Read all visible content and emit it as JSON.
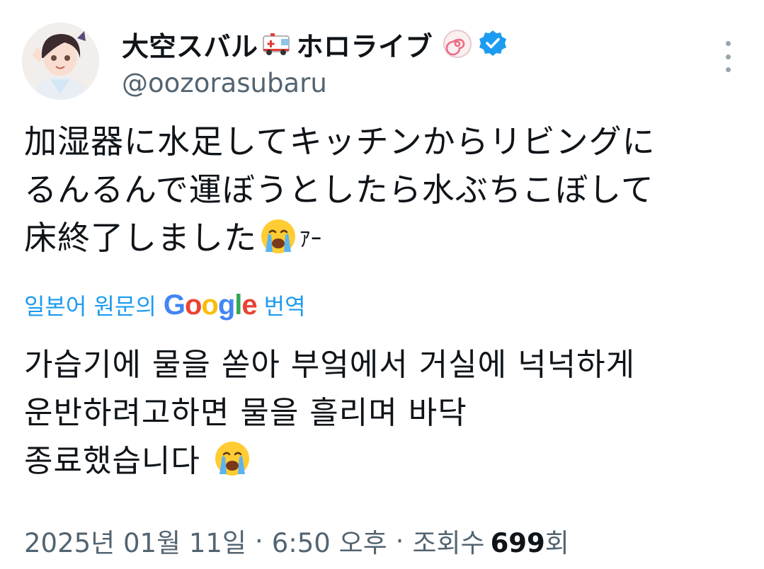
{
  "author": {
    "display_name": "大空スバル",
    "display_name_suffix": "ホロライブ",
    "handle": "@oozorasubaru",
    "verified_color": "#1d9bf0",
    "icons": [
      "ambulance-icon",
      "naruto-badge-icon",
      "verified-badge-icon"
    ]
  },
  "original_text": {
    "line1": "加湿器に水足してキッチンからリビングに",
    "line2": "るんるんで運ぼうとしたら水ぶちこぼして",
    "line3_before": "床終了しました",
    "line3_after": "ｱｰ"
  },
  "translate": {
    "prefix": "일본어 원문의",
    "google": [
      "G",
      "o",
      "o",
      "g",
      "l",
      "e"
    ],
    "suffix": "번역"
  },
  "translated_text": {
    "line1": "가습기에 물을 쏟아 부엌에서 거실에 넉넉하게",
    "line2": "운반하려고하면 물을 흘리며 바닥",
    "line3": "종료했습니다"
  },
  "meta": {
    "date": "2025년 01월 11일",
    "dot": "·",
    "time": "6:50 오후",
    "views_label": "조회수",
    "views_count": "699",
    "views_unit": "회"
  },
  "colors": {
    "link_blue": "#1d9bf0",
    "muted_gray": "#536471",
    "text_dark": "#0f1419"
  }
}
